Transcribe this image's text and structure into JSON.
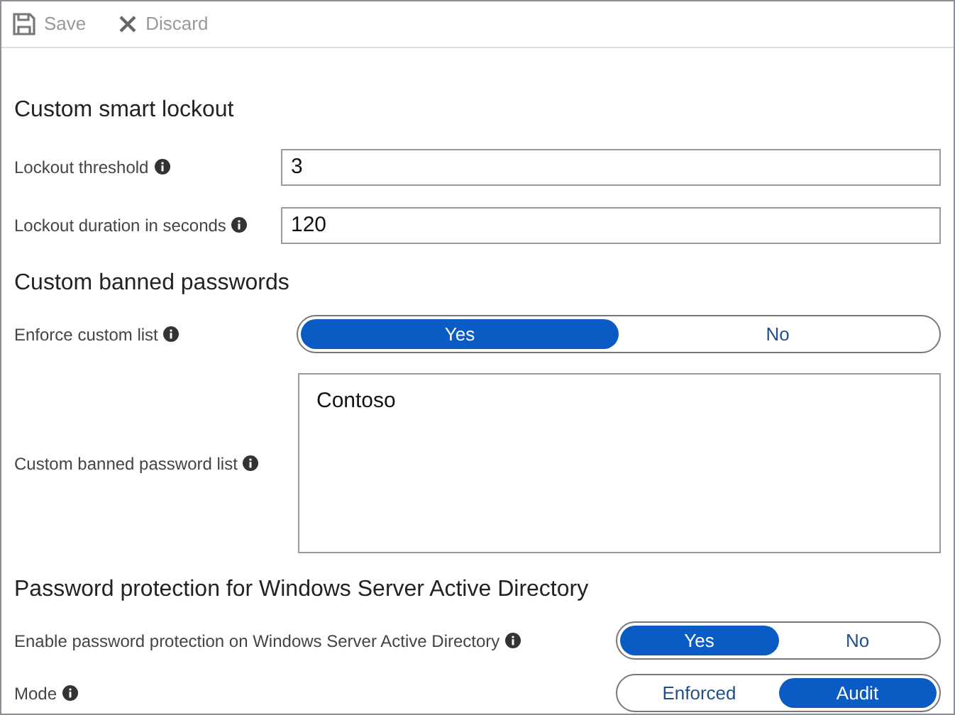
{
  "toolbar": [
    {
      "kind": "save",
      "label": "Save",
      "disabled": true
    },
    {
      "kind": "discard",
      "label": "Discard",
      "disabled": true
    }
  ],
  "sections": [
    {
      "title": "Custom smart lockout",
      "fields": [
        {
          "kind": "text",
          "label": "Lockout threshold",
          "value": "3"
        },
        {
          "kind": "text",
          "label": "Lockout duration in seconds",
          "value": "120"
        }
      ]
    },
    {
      "title": "Custom banned passwords",
      "fields": [
        {
          "kind": "toggle",
          "label": "Enforce custom list",
          "options": [
            {
              "label": "Yes",
              "selected": true
            },
            {
              "label": "No",
              "selected": false
            }
          ]
        },
        {
          "kind": "textarea",
          "label": "Custom banned password list",
          "value": "Contoso"
        }
      ]
    },
    {
      "title": "Password protection for Windows Server Active Directory",
      "fields": [
        {
          "kind": "toggle",
          "label": "Enable password protection on Windows Server Active Directory",
          "options": [
            {
              "label": "Yes",
              "selected": true
            },
            {
              "label": "No",
              "selected": false
            }
          ]
        },
        {
          "kind": "toggle",
          "label": "Mode",
          "options": [
            {
              "label": "Enforced",
              "selected": false
            },
            {
              "label": "Audit",
              "selected": true
            }
          ]
        }
      ]
    }
  ]
}
